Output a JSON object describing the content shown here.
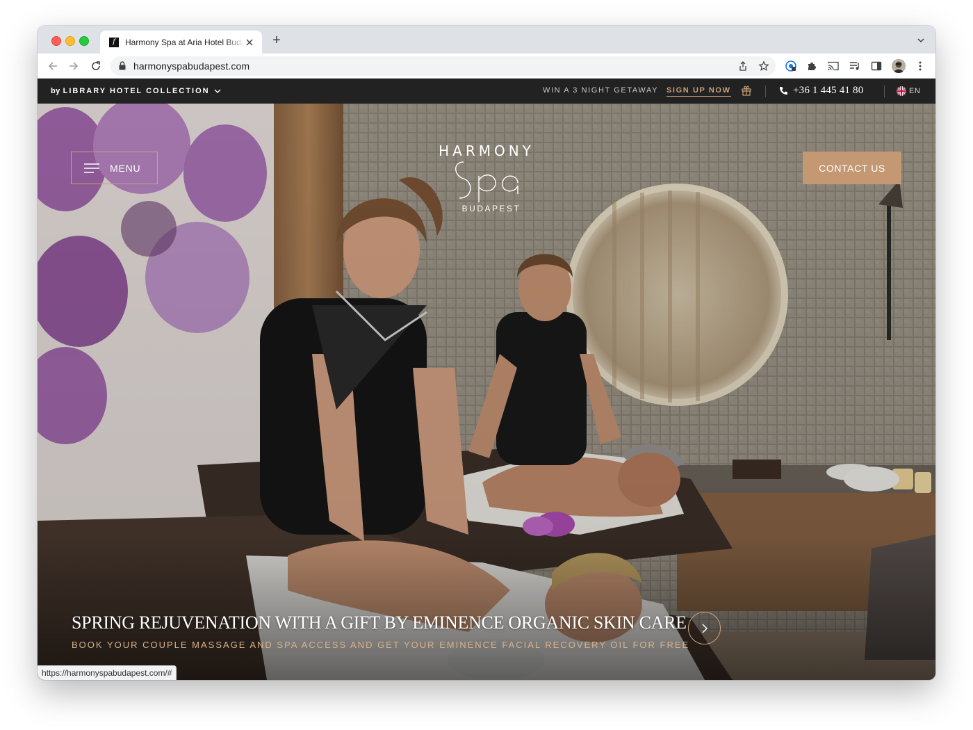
{
  "browser": {
    "tab_title": "Harmony Spa at Aria Hotel Budapest",
    "tab_favicon": "f",
    "new_tab_symbol": "+",
    "url": "harmonyspabudapest.com",
    "status_url": "https://harmonyspabudapest.com/#"
  },
  "topbar": {
    "by": "by",
    "collection": "LIBRARY HOTEL COLLECTION",
    "promo": "WIN A 3 NIGHT GETAWAY",
    "signup": "SIGN UP NOW",
    "phone": "+36 1 445 41 80",
    "language": "EN"
  },
  "hero": {
    "menu_label": "MENU",
    "logo_top": "HARMONY",
    "logo_bottom": "BUDAPEST",
    "contact_label": "CONTACT US",
    "slide_title": "SPRING REJUVENATION WITH A GIFT BY EMINENCE ORGANIC SKIN CARE",
    "slide_subtitle": "BOOK YOUR COUPLE MASSAGE AND SPA ACCESS AND GET YOUR EMINENCE FACIAL RECOVERY OIL FOR FREE"
  },
  "icons": {
    "back": "back-arrow-icon",
    "forward": "forward-arrow-icon",
    "reload": "reload-icon",
    "lock": "lock-icon",
    "share": "share-icon",
    "bookmark": "star-icon",
    "gift": "gift-icon",
    "phone": "phone-icon",
    "hamburger": "hamburger-icon",
    "next": "chevron-right-icon"
  },
  "colors": {
    "accent_gold": "#c39872",
    "topbar_bg": "#222222",
    "subtitle_gold": "#d8b18b"
  }
}
